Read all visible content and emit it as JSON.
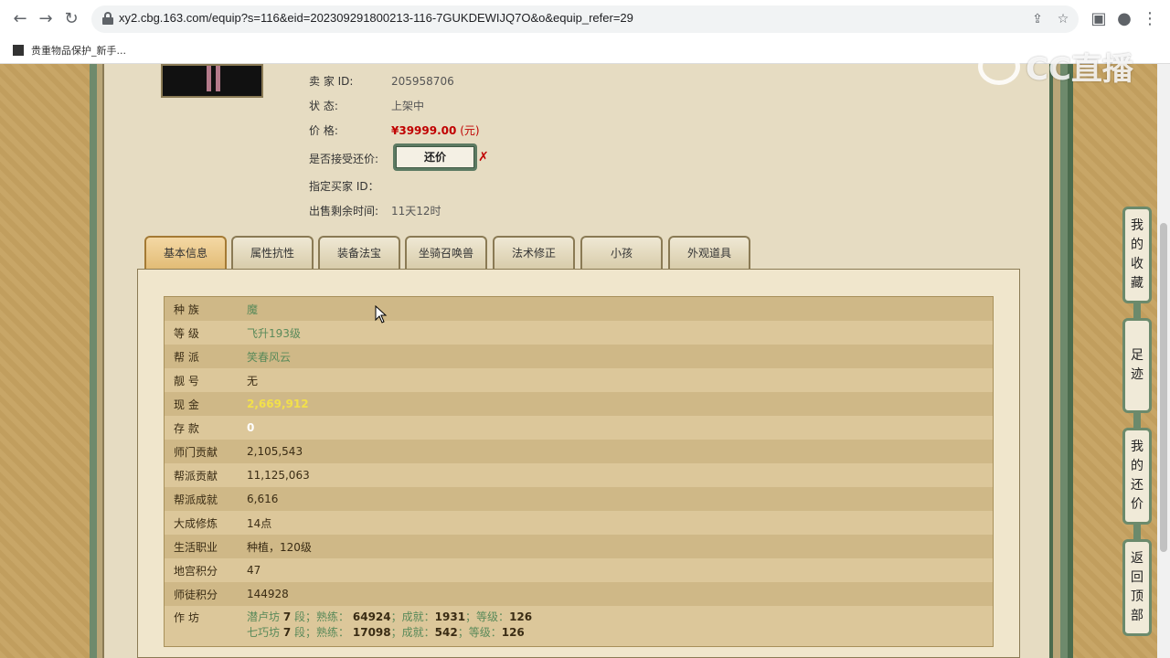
{
  "browser": {
    "url": "xy2.cbg.163.com/equip?s=116&eid=202309291800213-116-7GUKDEWIJQ7O&o&equip_refer=29",
    "bookmark": "贵重物品保护_新手..."
  },
  "watermark": "CC直播",
  "seller": {
    "seller_label": "卖  家    ID:",
    "seller_id": "205958706",
    "status_label": "状          态:",
    "status_value": "上架中",
    "price_label": "价          格:",
    "price_value": "¥39999.00",
    "price_unit": "(元)",
    "counter_label": "是否接受还价:",
    "counter_button": "还价",
    "buyer_label": "指定买家 ID：",
    "time_label": "出售剩余时间:",
    "time_value": "11天12时"
  },
  "tabs": [
    "基本信息",
    "属性抗性",
    "装备法宝",
    "坐骑召唤兽",
    "法术修正",
    "小孩",
    "外观道具"
  ],
  "rows": [
    {
      "label": "种    族",
      "value": "魔"
    },
    {
      "label": "等    级",
      "value": "飞升193级"
    },
    {
      "label": "帮    派",
      "value": "笑春风云"
    },
    {
      "label": "靓    号",
      "value": "无"
    },
    {
      "label": "现    金",
      "value": "2,669,912"
    },
    {
      "label": "存    款",
      "value": "0"
    },
    {
      "label": "师门贡献",
      "value": "2,105,543"
    },
    {
      "label": "帮派贡献",
      "value": "11,125,063"
    },
    {
      "label": "帮派成就",
      "value": "6,616"
    },
    {
      "label": "大成修炼",
      "value": "14点"
    },
    {
      "label": "生活职业",
      "value": "种植，120级"
    },
    {
      "label": "地宫积分",
      "value": "47"
    },
    {
      "label": "师徒积分",
      "value": "144928"
    }
  ],
  "workshop": {
    "label": "作    坊",
    "line1": {
      "name": "潜卢坊",
      "level": "7",
      "seg": "段；熟练：",
      "skill": "64924",
      "ach_label": "；成就：",
      "ach": "1931",
      "lvl_label": "；等级：",
      "lvl": "126"
    },
    "line2": {
      "name": "七巧坊",
      "level": "7",
      "seg": "段；熟练：",
      "skill": "17098",
      "ach_label": "；成就：",
      "ach": "542",
      "lvl_label": "；等级：",
      "lvl": "126"
    }
  },
  "side_buttons": {
    "favorites": "我的收藏",
    "footprint": "足迹",
    "my_counter": "我的还价",
    "top": "返回顶部"
  },
  "colors": {
    "accent_green": "#5a8a5a",
    "price_red": "#c00000",
    "cash_yellow": "#f2e04a"
  }
}
